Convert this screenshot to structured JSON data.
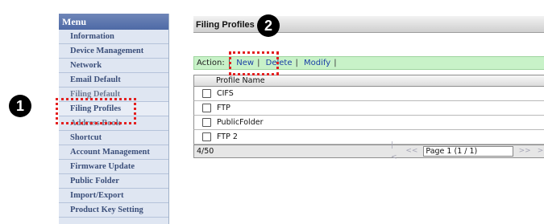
{
  "menu": {
    "header": "Menu",
    "items": [
      {
        "label": "Information"
      },
      {
        "label": "Device Management"
      },
      {
        "label": "Network"
      },
      {
        "label": "Email Default"
      },
      {
        "label": "Filing Default"
      },
      {
        "label": "Filing Profiles"
      },
      {
        "label": "Address Book"
      },
      {
        "label": "Shortcut"
      },
      {
        "label": "Account Management"
      },
      {
        "label": "Firmware Update"
      },
      {
        "label": "Public Folder"
      },
      {
        "label": "Import/Export"
      },
      {
        "label": "Product Key Setting"
      }
    ]
  },
  "markers": {
    "one": "❶",
    "two": "❷"
  },
  "panel": {
    "title": "Filing Profiles",
    "action_label": "Action:",
    "actions": {
      "new": "New",
      "delete": "Delete",
      "modify": "Modify"
    },
    "table": {
      "column": "Profile Name",
      "rows": [
        "CIFS",
        "FTP",
        "PublicFolder",
        "FTP 2"
      ]
    },
    "footer": {
      "count": "4/50",
      "first": "|<",
      "prev": "<<",
      "page": "Page 1 (1 / 1)",
      "next": ">>",
      "last": ">|"
    }
  },
  "colors": {
    "highlight": "#e32020",
    "action_bar": "#c8f2c8",
    "menu_bg": "#dfe6f2",
    "link": "#1a3fa6"
  }
}
